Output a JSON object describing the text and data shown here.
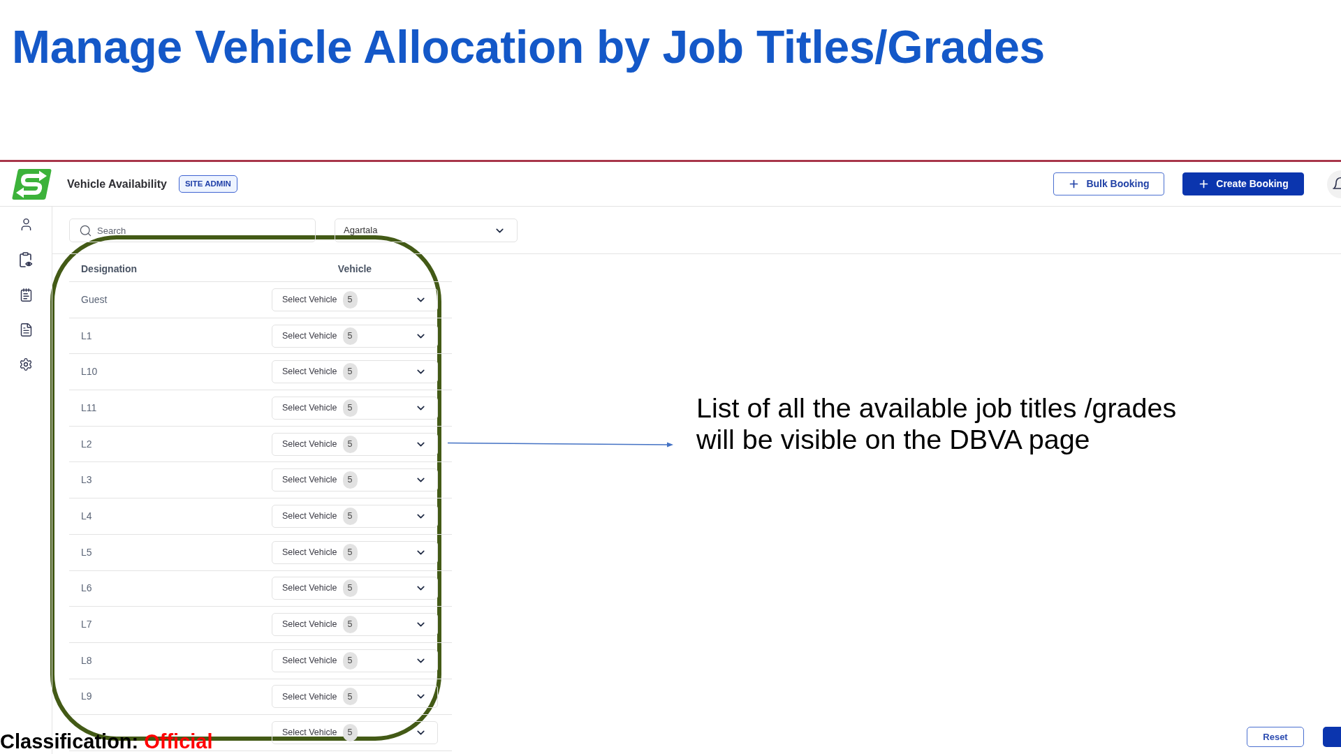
{
  "slide_title": "Manage Vehicle Allocation by Job Titles/Grades",
  "app": {
    "header": {
      "title": "Vehicle Availability",
      "role_badge": "SITE ADMIN",
      "actions": [
        {
          "label": "Bulk Booking",
          "kind": "outline"
        },
        {
          "label": "Create Booking",
          "kind": "primary"
        }
      ]
    },
    "filters": {
      "search": {
        "placeholder": "Search"
      },
      "location": {
        "value": "Agartala"
      }
    },
    "table": {
      "columns": [
        "Designation",
        "Vehicle"
      ],
      "rows": [
        {
          "designation": "Guest",
          "vehicle_select": {
            "text": "Select Vehicle",
            "count": "5"
          }
        },
        {
          "designation": "L1",
          "vehicle_select": {
            "text": "Select Vehicle",
            "count": "5"
          }
        },
        {
          "designation": "L10",
          "vehicle_select": {
            "text": "Select Vehicle",
            "count": "5"
          }
        },
        {
          "designation": "L11",
          "vehicle_select": {
            "text": "Select Vehicle",
            "count": "5"
          }
        },
        {
          "designation": "L2",
          "vehicle_select": {
            "text": "Select Vehicle",
            "count": "5"
          }
        },
        {
          "designation": "L3",
          "vehicle_select": {
            "text": "Select Vehicle",
            "count": "5"
          }
        },
        {
          "designation": "L4",
          "vehicle_select": {
            "text": "Select Vehicle",
            "count": "5"
          }
        },
        {
          "designation": "L5",
          "vehicle_select": {
            "text": "Select Vehicle",
            "count": "5"
          }
        },
        {
          "designation": "L6",
          "vehicle_select": {
            "text": "Select Vehicle",
            "count": "5"
          }
        },
        {
          "designation": "L7",
          "vehicle_select": {
            "text": "Select Vehicle",
            "count": "5"
          }
        },
        {
          "designation": "L8",
          "vehicle_select": {
            "text": "Select Vehicle",
            "count": "5"
          }
        },
        {
          "designation": "L9",
          "vehicle_select": {
            "text": "Select Vehicle",
            "count": "5"
          }
        },
        {
          "vehicle_select": {
            "text": "Select Vehicle",
            "count": "5"
          }
        }
      ]
    },
    "footer": {
      "buttons": [
        {
          "label": "Reset",
          "kind": "outline"
        },
        {
          "kind": "primary"
        }
      ]
    }
  },
  "annotation": {
    "text": "List of all the available job titles /grades\nwill be visible on the DBVA page"
  },
  "classification": {
    "label": "Classification:",
    "value": "Official"
  }
}
